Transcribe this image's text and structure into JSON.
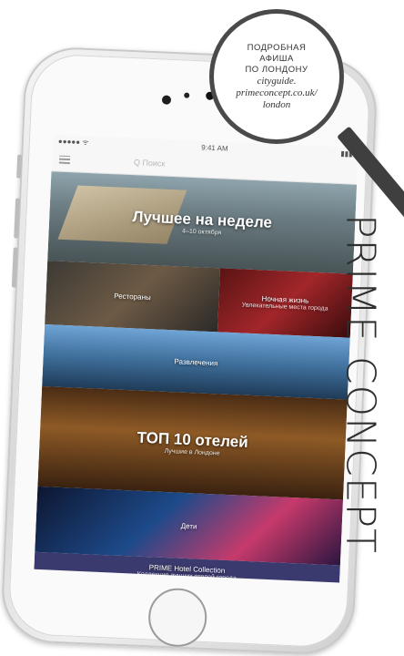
{
  "magnifier": {
    "line1": "ПОДРОБНАЯ",
    "line2": "АФИША",
    "line3": "ПО ЛОНДОНУ",
    "url1": "cityguide.",
    "url2": "primeconcept.co.uk/",
    "url3": "london"
  },
  "brand": "PRIME CONCEPT",
  "app": {
    "status_left": "●●●●● ᯤ",
    "status_time": "9:41 AM",
    "status_right": "▮▮▮",
    "search_placeholder": "Q Поиск",
    "tiles": [
      {
        "title": "Лучшее на неделе",
        "subtitle": "4–10 октября"
      },
      {
        "title": "Рестораны"
      },
      {
        "title": "Ночная жизнь",
        "subtitle": "Увлекательные места города"
      },
      {
        "title": "Развлечения"
      },
      {
        "title": "ТОП 10 отелей",
        "subtitle": "Лучшие в Лондоне"
      },
      {
        "title": "Дети"
      },
      {
        "title": "PRIME Hotel Collection",
        "subtitle": "Коллекция лучших отелей города"
      }
    ]
  }
}
